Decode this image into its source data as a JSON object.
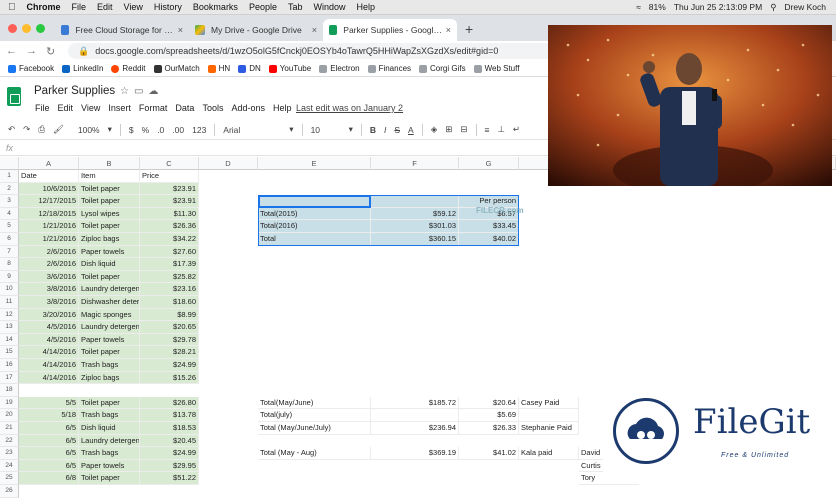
{
  "menubar": {
    "app": "Chrome",
    "items": [
      "File",
      "Edit",
      "View",
      "History",
      "Bookmarks",
      "People",
      "Tab",
      "Window",
      "Help"
    ],
    "battery": "81%",
    "clock": "Thu Jun 25  2:13:09 PM",
    "user": "Drew Koch"
  },
  "tabs": [
    {
      "title": "Free Cloud Storage for Personal"
    },
    {
      "title": "My Drive - Google Drive"
    },
    {
      "title": "Parker Supplies - Google Sheets"
    }
  ],
  "address": {
    "url": "docs.google.com/spreadsheets/d/1wzO5olG5fCnckj0EOSYb4oTawrQ5HHiWapZsXGzdXs/edit#gid=0"
  },
  "bookmarks": [
    "Facebook",
    "LinkedIn",
    "Reddit",
    "OurMatch",
    "HN",
    "DN",
    "YouTube",
    "Electron",
    "Finances",
    "Corgi Gifs",
    "Web Stuff"
  ],
  "sheet": {
    "title": "Parker Supplies",
    "menu": [
      "File",
      "Edit",
      "View",
      "Insert",
      "Format",
      "Data",
      "Tools",
      "Add-ons",
      "Help"
    ],
    "last_edit": "Last edit was on January 2"
  },
  "toolbar": {
    "zoom": "100%",
    "currency": "$",
    "percent": "%",
    "dec1": ".0",
    "dec2": ".00",
    "format": "123",
    "font": "Arial",
    "size": "10"
  },
  "formula": {
    "fx": "fx"
  },
  "columns": [
    "A",
    "B",
    "C",
    "D",
    "E",
    "F",
    "G"
  ],
  "headers": {
    "date": "Date",
    "item": "Item",
    "price": "Price"
  },
  "rows_a": [
    [
      "10/6/2015",
      "Toilet paper",
      "$23.91"
    ],
    [
      "12/17/2015",
      "Toilet paper",
      "$23.91"
    ],
    [
      "12/18/2015",
      "Lysol wipes",
      "$11.30"
    ],
    [
      "1/21/2016",
      "Toilet paper",
      "$26.36"
    ],
    [
      "1/21/2016",
      "Ziploc bags",
      "$34.22"
    ],
    [
      "2/6/2016",
      "Paper towels",
      "$27.60"
    ],
    [
      "2/6/2016",
      "Dish liquid",
      "$17.39"
    ],
    [
      "3/6/2016",
      "Toilet paper",
      "$25.82"
    ],
    [
      "3/8/2016",
      "Laundry detergent",
      "$23.16"
    ],
    [
      "3/8/2016",
      "Dishwasher detergent",
      "$18.60"
    ],
    [
      "3/20/2016",
      "Magic sponges",
      "$8.99"
    ],
    [
      "4/5/2016",
      "Laundry detergent",
      "$20.65"
    ],
    [
      "4/5/2016",
      "Paper towels",
      "$29.78"
    ],
    [
      "4/14/2016",
      "Toilet paper",
      "$28.21"
    ],
    [
      "4/14/2016",
      "Trash bags",
      "$24.99"
    ],
    [
      "4/14/2016",
      "Ziploc bags",
      "$15.26"
    ]
  ],
  "rows_b": [
    [
      "5/5",
      "Toilet paper",
      "$26.80"
    ],
    [
      "5/18",
      "Trash bags",
      "$13.78"
    ],
    [
      "6/5",
      "Dish liquid",
      "$18.53"
    ],
    [
      "6/5",
      "Laundry detergent",
      "$20.45"
    ],
    [
      "6/5",
      "Trash bags",
      "$24.99"
    ],
    [
      "6/5",
      "Paper towels",
      "$29.95"
    ],
    [
      "6/8",
      "Toilet paper",
      "$51.22"
    ]
  ],
  "summary": {
    "per_person": "Per person",
    "r1": [
      "Total(2015)",
      "$59.12",
      "$6.57"
    ],
    "r2": [
      "Total(2016)",
      "$301.03",
      "$33.45"
    ],
    "r3": [
      "Total",
      "$360.15",
      "$40.02"
    ]
  },
  "summary2": [
    [
      "Total(May/June)",
      "$185.72",
      "$20.64",
      "Casey Paid"
    ],
    [
      "Total(july)",
      "",
      "$5.69",
      ""
    ],
    [
      "Total (May/June/July)",
      "$236.94",
      "$26.33",
      "Stephanie Paid"
    ],
    [
      "Total (May - Aug)",
      "$369.19",
      "$41.02",
      "Kala paid"
    ]
  ],
  "names": [
    "David",
    "Curtis",
    "Tory"
  ],
  "watermark": {
    "main": "FileGit",
    "sub": "Free & Unlimited",
    "faint": "FILECR.com"
  }
}
